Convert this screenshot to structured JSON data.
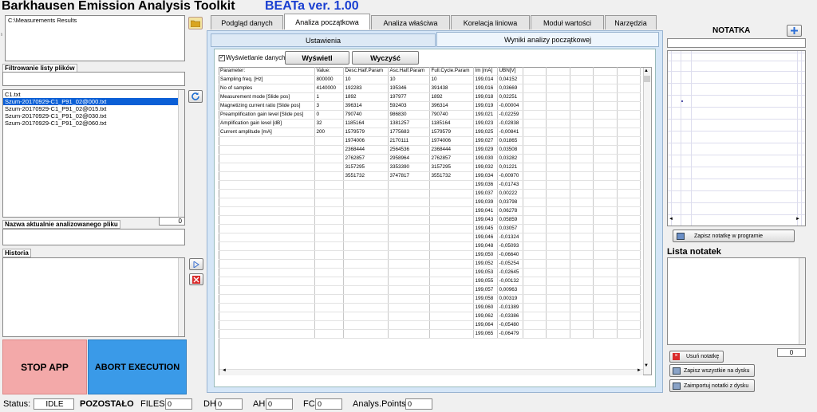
{
  "app": {
    "title": "Barkhausen Emission Analysis Toolkit",
    "version": "BEATa ver. 1.00"
  },
  "left": {
    "path": "C:\\Measurements Results",
    "filter_label": "Filtrowanie listy plików",
    "files": [
      "C1.txt",
      "Szum-20170929-C1_P91_02@000.txt",
      "Szum-20170929-C1_P91_02@015.txt",
      "Szum-20170929-C1_P91_02@030.txt",
      "Szum-20170929-C1_P91_02@060.txt"
    ],
    "selected_file_index": 1,
    "current_file_label": "Nazwa aktualnie analizowanego pliku",
    "current_file_count": "0",
    "history_label": "Historia"
  },
  "buttons": {
    "stop": "STOP APP",
    "abort": "ABORT EXECUTION"
  },
  "tabs": [
    "Podgląd danych",
    "Analiza początkowa",
    "Analiza właściwa",
    "Korelacja liniowa",
    "Moduł wartości",
    "Narzędzia"
  ],
  "subtabs": [
    "Ustawienia",
    "Wyniki analizy początkowej"
  ],
  "toolbar": {
    "checkbox_label": "Wyświetlanie danych",
    "show_btn": "Wyświetl",
    "clear_btn": "Wyczyść"
  },
  "table": {
    "headers": [
      "Parameter:",
      "Value:",
      "Desc.Half.Param",
      "Asc.Half.Param",
      "Full.Cycle.Param",
      "Im [mA]",
      "UBN[V]",
      "",
      "",
      "",
      "",
      ""
    ],
    "params": [
      [
        "Sampling freq. [Hz]",
        "800000"
      ],
      [
        "No of samples",
        "4140000"
      ],
      [
        "Measurement mode [Slide pos]",
        "1"
      ],
      [
        "Magnetizing current ratio [Slide pos]",
        "3"
      ],
      [
        "Preamplification gain level [Slide pos]",
        "0"
      ],
      [
        "Amplification gain level [dB]",
        "32"
      ],
      [
        "Current amplitude [mA]",
        "200"
      ]
    ],
    "halfparams": [
      [
        "10",
        "10",
        "10"
      ],
      [
        "192283",
        "195346",
        "391438"
      ],
      [
        "1892",
        "197977",
        "1892"
      ],
      [
        "396314",
        "592403",
        "396314"
      ],
      [
        "790740",
        "986830",
        "790740"
      ],
      [
        "1185164",
        "1381257",
        "1185164"
      ],
      [
        "1579579",
        "1775683",
        "1579579"
      ],
      [
        "1974006",
        "2170111",
        "1974006"
      ],
      [
        "2368444",
        "2564536",
        "2368444"
      ],
      [
        "2762857",
        "2958964",
        "2762857"
      ],
      [
        "3157295",
        "3353390",
        "3157295"
      ],
      [
        "3551732",
        "3747817",
        "3551732"
      ]
    ],
    "im_ubn": [
      [
        "199,014",
        "0,04152"
      ],
      [
        "199,016",
        "0,03669"
      ],
      [
        "199,018",
        "0,02251"
      ],
      [
        "199,019",
        "-0,00004"
      ],
      [
        "199,021",
        "-0,02259"
      ],
      [
        "199,023",
        "-0,02838"
      ],
      [
        "199,025",
        "-0,00841"
      ],
      [
        "199,027",
        "0,01865"
      ],
      [
        "199,029",
        "0,03508"
      ],
      [
        "199,030",
        "0,03282"
      ],
      [
        "199,032",
        "0,01221"
      ],
      [
        "199,034",
        "-0,00970"
      ],
      [
        "199,036",
        "-0,01743"
      ],
      [
        "199,037",
        "0,00222"
      ],
      [
        "199,039",
        "0,03798"
      ],
      [
        "199,041",
        "0,06278"
      ],
      [
        "199,043",
        "0,05859"
      ],
      [
        "199,045",
        "0,03057"
      ],
      [
        "199,046",
        "-0,01324"
      ],
      [
        "199,048",
        "-0,05093"
      ],
      [
        "199,050",
        "-0,06640"
      ],
      [
        "199,052",
        "-0,05254"
      ],
      [
        "199,053",
        "-0,02645"
      ],
      [
        "199,055",
        "-0,00132"
      ],
      [
        "199,057",
        "0,00963"
      ],
      [
        "199,058",
        "0,00319"
      ],
      [
        "199,060",
        "-0,01389"
      ],
      [
        "199,062",
        "-0,03386"
      ],
      [
        "199,064",
        "-0,05480"
      ],
      [
        "199,065",
        "-0,06479"
      ]
    ]
  },
  "notes": {
    "title": "NOTATKA",
    "save_program": "Zapisz notatkę w programie",
    "list_title": "Lista notatek",
    "count": "0",
    "delete": "Usuń notatkę",
    "save_all": "Zapisz wszystkie na dysku",
    "import": "Zaimportuj notatki z dysku"
  },
  "status": {
    "status_label": "Status:",
    "status_value": "IDLE",
    "remaining": "POZOSTAŁO",
    "files_label": "FILES",
    "files_value": "0",
    "dh_label": "DH",
    "dh_value": "0",
    "ah_label": "AH",
    "ah_value": "0",
    "fc_label": "FC",
    "fc_value": "0",
    "ap_label": "Analys.Points",
    "ap_value": "0"
  },
  "colors": {
    "accent": "#1a3fd1",
    "stop": "#f3a9a9",
    "abort": "#3a9ae8",
    "selection": "#0b5fd6"
  }
}
